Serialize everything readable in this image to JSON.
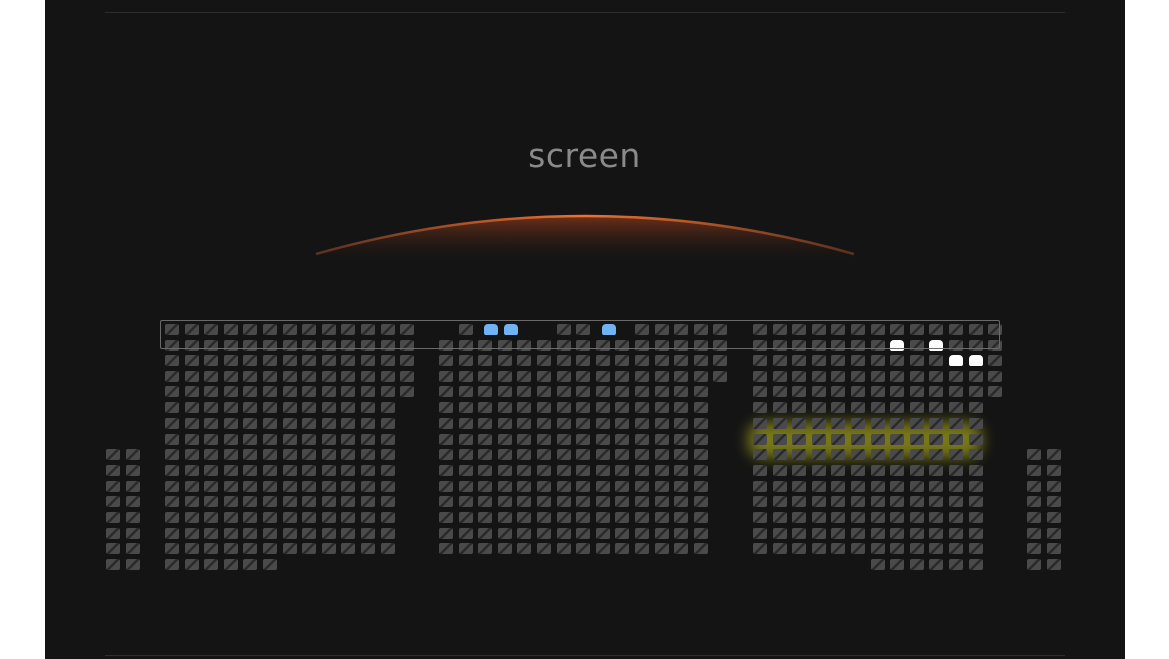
{
  "screen": {
    "label": "screen"
  },
  "colors": {
    "background": "#141414",
    "seat": "#4a4a4a",
    "seat_hatch": "#2a2a2a",
    "selected": "#6fb3f5",
    "reserved": "#ffffff",
    "screen_glow": "#e0622a",
    "highlight": "#c8c81e"
  },
  "legend_states": [
    "available",
    "selected",
    "reserved"
  ],
  "highlighted_row": 8,
  "icons": {
    "seat": "seat-icon"
  }
}
